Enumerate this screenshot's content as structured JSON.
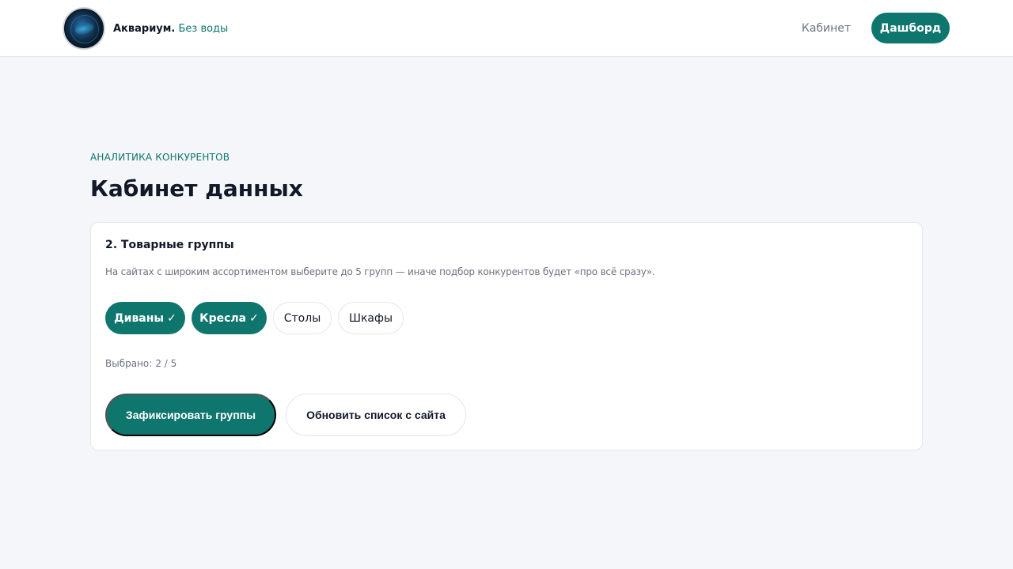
{
  "header": {
    "brand_name": "Аквариум.",
    "brand_tagline": "Без воды",
    "nav_link": "Кабинет",
    "nav_button": "Дашборд"
  },
  "page": {
    "eyebrow": "АНАЛИТИКА КОНКУРЕНТОВ",
    "title": "Кабинет данных"
  },
  "card": {
    "title": "2. Товарные группы",
    "description": "На сайтах с широким ассортиментом выберите до 5 групп — иначе подбор конкурентов будет «про всё сразу».",
    "chips": [
      {
        "label": "Диваны",
        "selected": true,
        "check": "✓"
      },
      {
        "label": "Кресла",
        "selected": true,
        "check": "✓"
      },
      {
        "label": "Столы",
        "selected": false
      },
      {
        "label": "Шкафы",
        "selected": false
      }
    ],
    "counter_label": "Выбрано:",
    "counter_value": "2 / 5",
    "primary_button": "Зафиксировать группы",
    "secondary_button": "Обновить список с сайта"
  },
  "colors": {
    "accent": "#0f766e",
    "background": "#f4f6f9",
    "text": "#111827",
    "muted": "#6b7280"
  }
}
